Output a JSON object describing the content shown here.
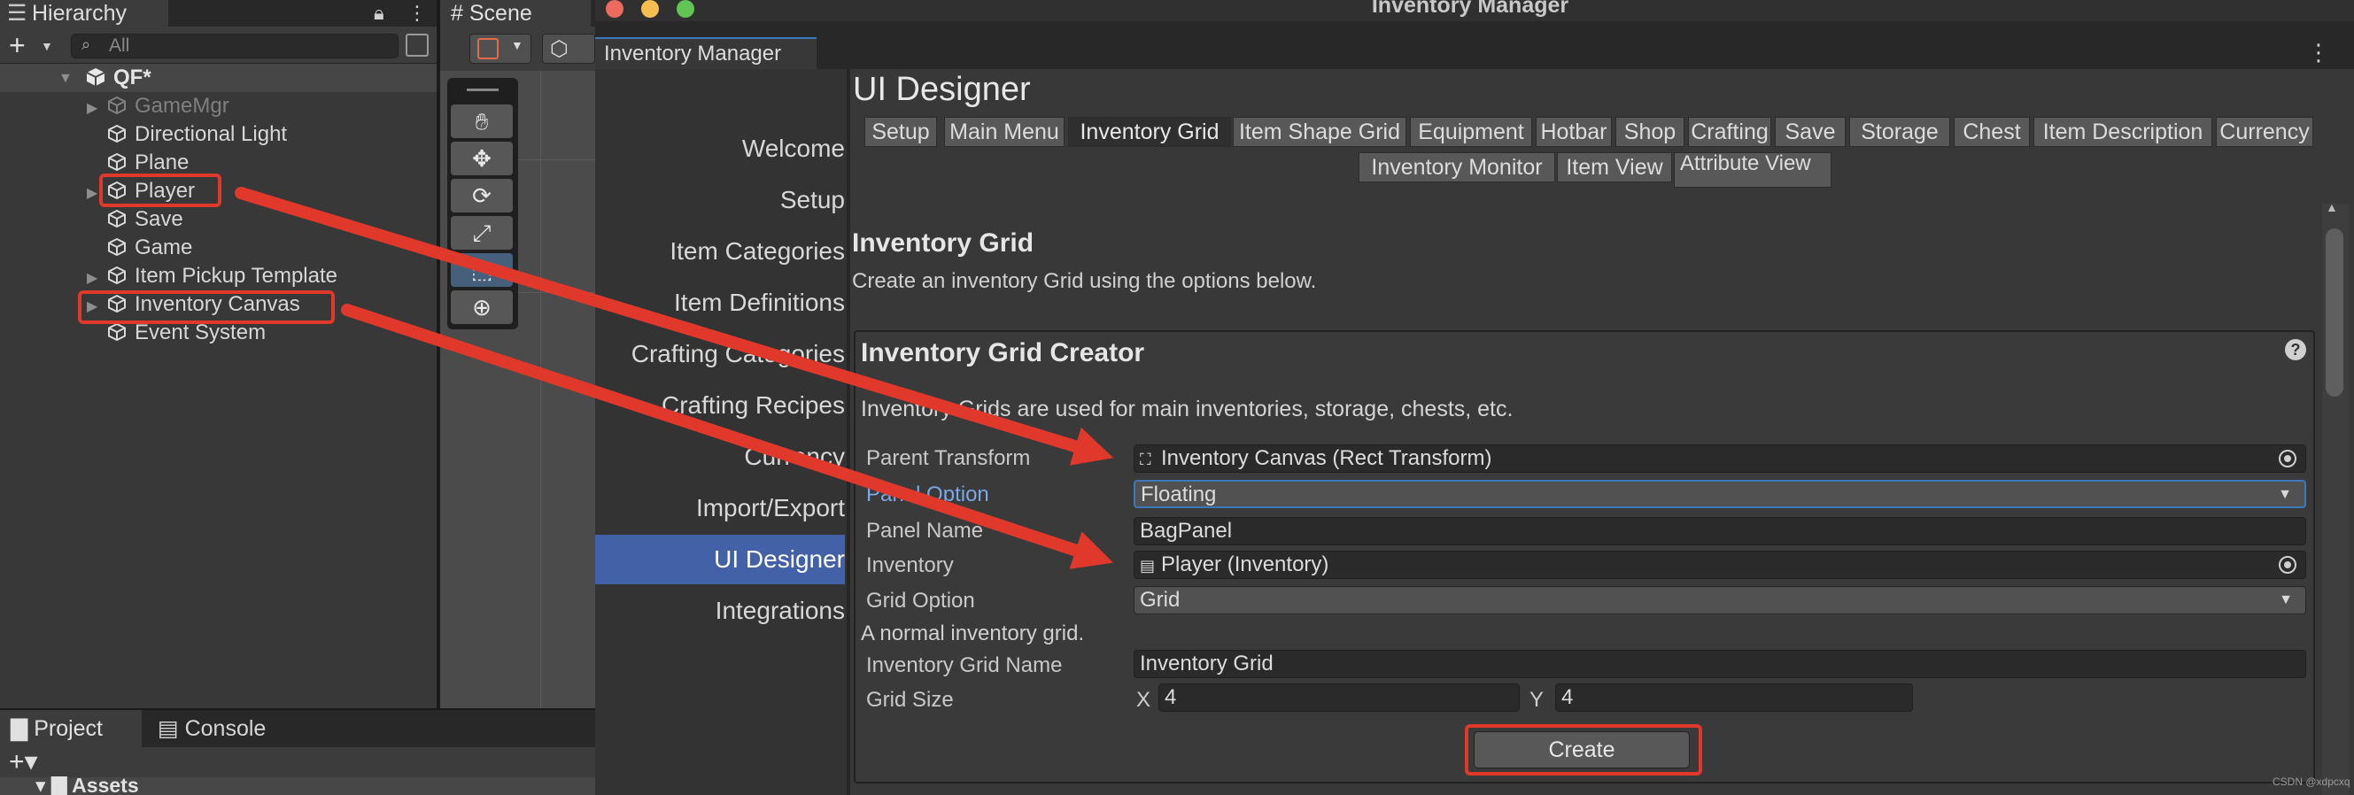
{
  "hierarchy": {
    "tab_label": "Hierarchy",
    "search_placeholder": "All",
    "root": "QF*",
    "items": [
      {
        "label": "GameMgr",
        "dim": true,
        "expandable": true
      },
      {
        "label": "Directional Light",
        "dim": false,
        "expandable": false
      },
      {
        "label": "Plane",
        "dim": false,
        "expandable": false
      },
      {
        "label": "Player",
        "dim": false,
        "expandable": true
      },
      {
        "label": "Save",
        "dim": false,
        "expandable": false
      },
      {
        "label": "Game",
        "dim": false,
        "expandable": false
      },
      {
        "label": "Item Pickup Template",
        "dim": false,
        "expandable": true
      },
      {
        "label": "Inventory Canvas",
        "dim": false,
        "expandable": true
      },
      {
        "label": "Event System",
        "dim": false,
        "expandable": false
      }
    ]
  },
  "scene": {
    "tab_label": "Scene"
  },
  "bottom": {
    "project_tab": "Project",
    "console_tab": "Console",
    "assets_label": "Assets"
  },
  "window": {
    "title": "Inventory Manager",
    "tab_label": "Inventory Manager"
  },
  "nav": {
    "items": [
      "Welcome",
      "Setup",
      "Item Categories",
      "Item Definitions",
      "Crafting Categories",
      "Crafting Recipes",
      "Currency",
      "Import/Export",
      "UI Designer",
      "Integrations"
    ],
    "active": "UI Designer"
  },
  "designer": {
    "title": "UI Designer",
    "tabs_row1": [
      "Setup",
      "Main Menu",
      "Inventory Grid",
      "Item Shape Grid",
      "Equipment",
      "Hotbar",
      "Shop",
      "Crafting",
      "Save",
      "Storage",
      "Chest",
      "Item Description",
      "Currency"
    ],
    "tabs_row2": [
      "Inventory Monitor",
      "Item View",
      "Attribute View"
    ],
    "selected_tab": "Inventory Grid",
    "section_title": "Inventory Grid",
    "section_desc": "Create an inventory Grid using the options below."
  },
  "creator": {
    "title": "Inventory Grid Creator",
    "help": "?",
    "description": "Inventory Grids are used for main inventories, storage, chests, etc.",
    "fields": {
      "parent_transform": {
        "label": "Parent Transform",
        "value": "Inventory Canvas (Rect Transform)"
      },
      "panel_option": {
        "label": "Panel Option",
        "value": "Floating"
      },
      "panel_name": {
        "label": "Panel Name",
        "value": "BagPanel"
      },
      "inventory": {
        "label": "Inventory",
        "value": "Player (Inventory)"
      },
      "grid_option": {
        "label": "Grid Option",
        "value": "Grid"
      },
      "grid_hint": "A normal inventory grid.",
      "grid_name": {
        "label": "Inventory Grid Name",
        "value": "Inventory Grid"
      },
      "grid_size": {
        "label": "Grid Size",
        "x_label": "X",
        "x": "4",
        "y_label": "Y",
        "y": "4"
      }
    },
    "create_label": "Create"
  },
  "watermark": "CSDN @xdpcxq",
  "colors": {
    "accent": "#3a79bb",
    "nav_active": "#4361a6",
    "annotation_red": "#e0382b"
  }
}
